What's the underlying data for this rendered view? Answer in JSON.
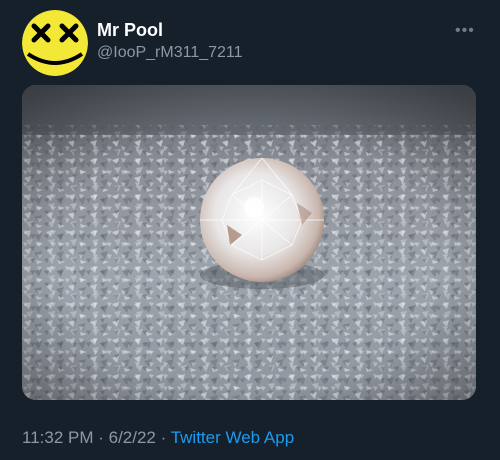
{
  "user": {
    "display_name": "Mr Pool",
    "handle": "@IooP_rM311_7211",
    "avatar_icon": "yellow-dead-face-icon"
  },
  "more_icon": "ellipsis-icon",
  "media": {
    "image": "diamond-on-broken-glass"
  },
  "meta": {
    "time": "11:32 PM",
    "separator1": " · ",
    "date": "6/2/22",
    "separator2": " · ",
    "source": "Twitter Web App"
  },
  "colors": {
    "background": "#15202b",
    "secondary_text": "#8b98a5",
    "link": "#1d9bf0",
    "avatar_yellow": "#f4e837"
  }
}
